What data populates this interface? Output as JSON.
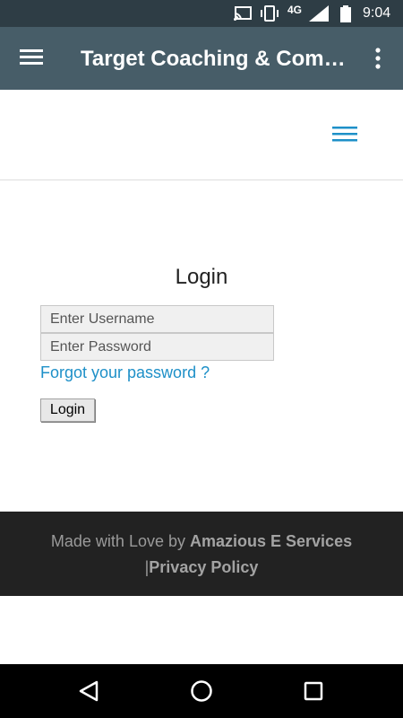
{
  "status_bar": {
    "network_label": "4G",
    "time": "9:04",
    "icons": [
      "cast-icon",
      "vibrate-icon",
      "signal-icon",
      "battery-icon"
    ]
  },
  "app_bar": {
    "title": "Target Coaching & Comp...",
    "icons": [
      "hamburger-menu-icon",
      "overflow-menu-icon"
    ]
  },
  "web_header": {
    "icons": [
      "nav-toggle-icon"
    ],
    "accent_color": "#1e90c8"
  },
  "login": {
    "title": "Login",
    "username_placeholder": "Enter Username",
    "password_placeholder": "Enter Password",
    "forgot_link": "Forgot your password ?",
    "button_label": "Login"
  },
  "footer": {
    "made_with": "Made with Love by ",
    "company": "Amazious E Services",
    "separator": "|",
    "privacy": "Privacy Policy"
  },
  "nav_bar": {
    "icons": [
      "back-icon",
      "home-icon",
      "recent-apps-icon"
    ]
  }
}
